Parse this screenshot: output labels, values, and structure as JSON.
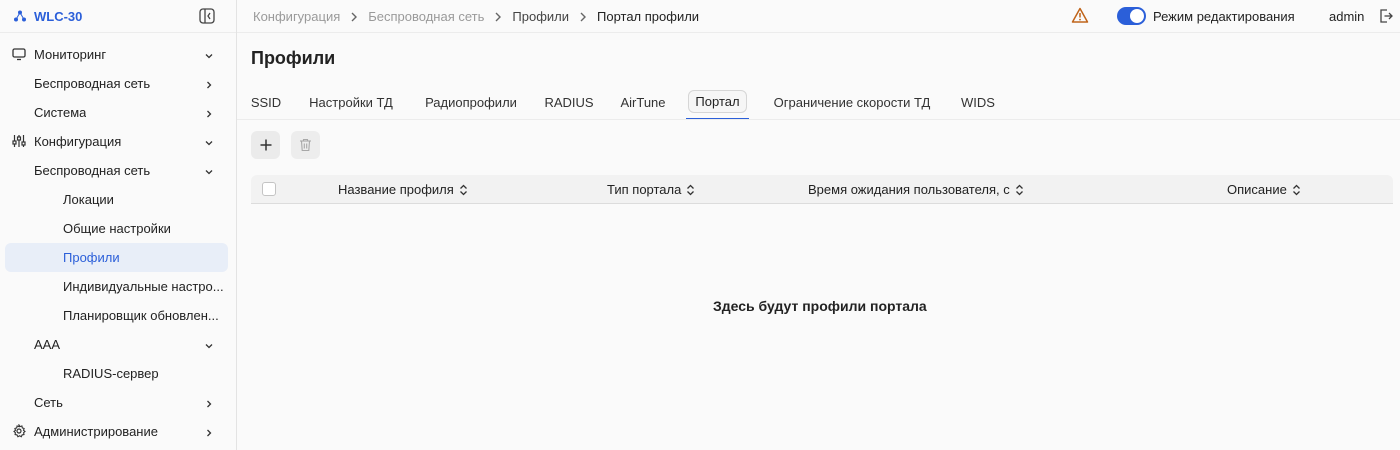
{
  "brand": {
    "name": "WLC-30",
    "accent": "#2b5fd9"
  },
  "sidebar": {
    "items": [
      {
        "label": "Мониторинг",
        "icon": "monitor-icon",
        "chevron": "down"
      },
      {
        "label": "Беспроводная сеть",
        "chevron": "right"
      },
      {
        "label": "Система",
        "chevron": "right"
      },
      {
        "label": "Конфигурация",
        "icon": "sliders-icon",
        "chevron": "down"
      },
      {
        "label": "Беспроводная сеть",
        "chevron": "down"
      },
      {
        "label": "Локации"
      },
      {
        "label": "Общие настройки"
      },
      {
        "label": "Профили",
        "active": true
      },
      {
        "label": "Индивидуальные настро..."
      },
      {
        "label": "Планировщик обновлен..."
      },
      {
        "label": "AAA",
        "chevron": "down"
      },
      {
        "label": "RADIUS-сервер"
      },
      {
        "label": "Сеть",
        "chevron": "right"
      },
      {
        "label": "Администрирование",
        "icon": "gear-icon",
        "chevron": "right"
      }
    ]
  },
  "breadcrumb": [
    "Конфигурация",
    "Беспроводная сеть",
    "Профили",
    "Портал профили"
  ],
  "header": {
    "edit_mode_label": "Режим редактирования",
    "edit_mode_on": true,
    "user": "admin"
  },
  "page": {
    "title": "Профили"
  },
  "tabs": [
    "SSID",
    "Настройки ТД",
    "Радиопрофили",
    "RADIUS",
    "AirTune",
    "Портал",
    "Ограничение скорости ТД",
    "WIDS"
  ],
  "active_tab": "Портал",
  "table": {
    "columns": [
      "Название профиля",
      "Тип портала",
      "Время ожидания пользователя, с",
      "Описание"
    ],
    "rows": [],
    "empty_text": "Здесь будут профили портала"
  }
}
